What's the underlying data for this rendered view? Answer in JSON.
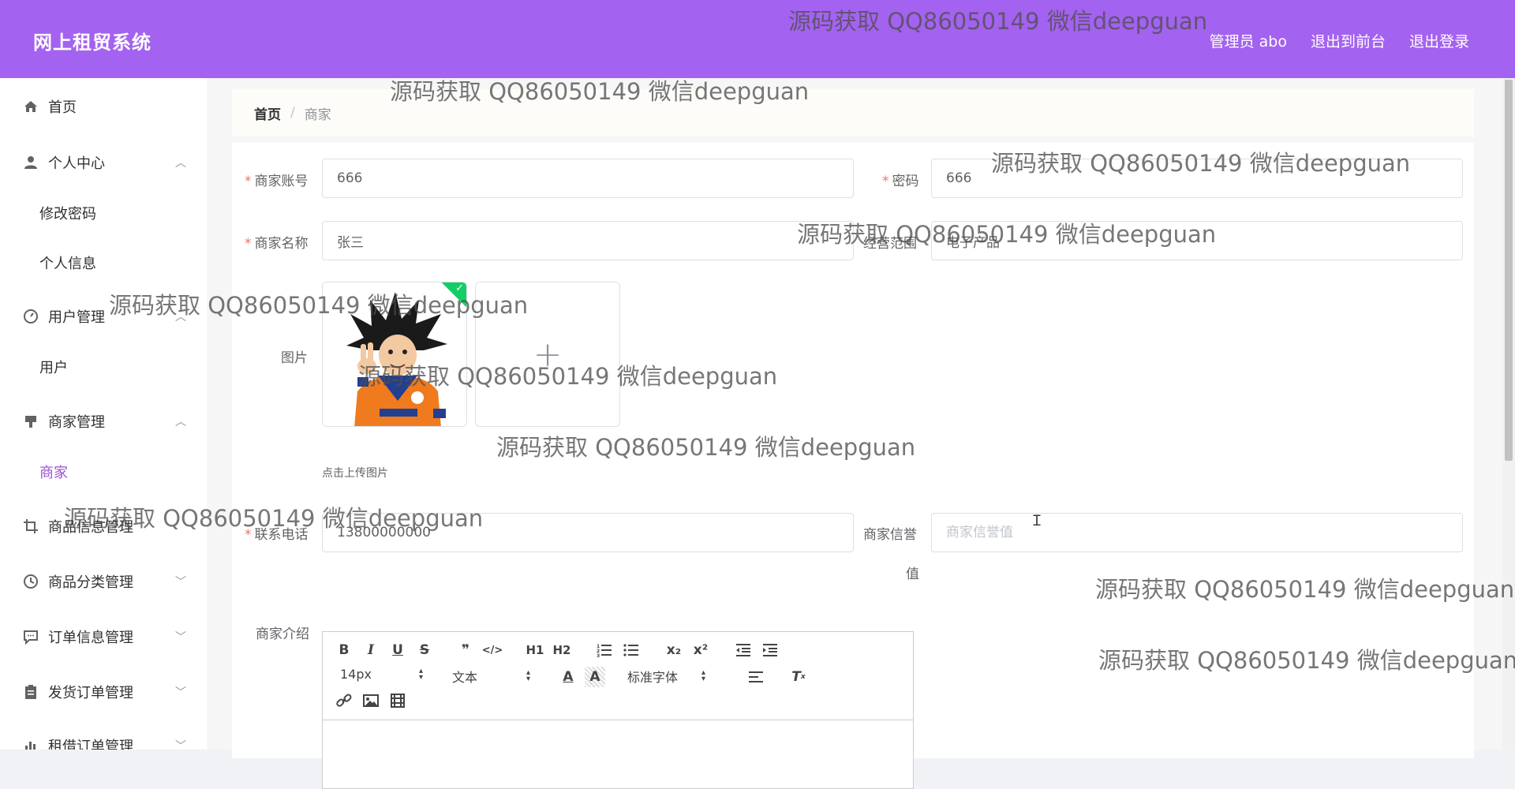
{
  "header": {
    "title": "网上租贸系统",
    "links": [
      "管理员 abo",
      "退出到前台",
      "退出登录"
    ]
  },
  "sidebar": {
    "items": [
      {
        "label": "首页",
        "icon": "home-icon"
      },
      {
        "label": "个人中心",
        "icon": "user-icon",
        "expanded": true
      },
      {
        "label": "修改密码",
        "sub": true
      },
      {
        "label": "个人信息",
        "sub": true
      },
      {
        "label": "用户管理",
        "icon": "gauge-icon",
        "expanded": true
      },
      {
        "label": "用户",
        "sub": true
      },
      {
        "label": "商家管理",
        "icon": "shop-icon",
        "expanded": true
      },
      {
        "label": "商家",
        "sub": true,
        "active": true
      },
      {
        "label": "商品信息管理",
        "icon": "crop-icon"
      },
      {
        "label": "商品分类管理",
        "icon": "clock-icon"
      },
      {
        "label": "订单信息管理",
        "icon": "chat-icon"
      },
      {
        "label": "发货订单管理",
        "icon": "clipboard-icon"
      },
      {
        "label": "租借订单管理",
        "icon": "chart-icon"
      }
    ]
  },
  "breadcrumb": {
    "home": "首页",
    "sep": "/",
    "current": "商家"
  },
  "form": {
    "account_label": "商家账号",
    "account_value": "666",
    "password_label": "密码",
    "password_value": "666",
    "name_label": "商家名称",
    "name_value": "张三",
    "scope_label": "经营范围",
    "scope_value": "电子产品",
    "image_label": "图片",
    "upload_tip": "点击上传图片",
    "phone_label": "联系电话",
    "phone_value": "13800000000",
    "credit_label_1": "商家信誉",
    "credit_label_2": "值",
    "credit_placeholder": "商家信誉值",
    "intro_label": "商家介绍"
  },
  "editor": {
    "buttons": [
      "B",
      "I",
      "U",
      "S",
      "❞",
      "</>",
      "H1",
      "H2",
      "ol",
      "ul",
      "x₂",
      "x²",
      "outdent",
      "indent"
    ],
    "font_size": "14px",
    "block_type": "文本",
    "font_family": "标准字体"
  },
  "watermark": "源码获取 QQ86050149 微信deepguan",
  "colors": {
    "header": "#a462f0",
    "active_menu": "#9b4ed6",
    "required": "#f56c6c"
  }
}
